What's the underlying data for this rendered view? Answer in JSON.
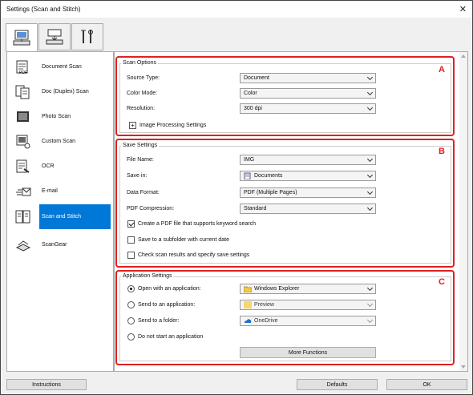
{
  "window": {
    "title": "Settings (Scan and Stitch)"
  },
  "tabs": [
    {
      "name": "scan-from-computer-tab"
    },
    {
      "name": "scan-from-panel-tab"
    },
    {
      "name": "general-settings-tab"
    }
  ],
  "nav": {
    "items": [
      {
        "label": "Document Scan",
        "icon": "document-scan-icon"
      },
      {
        "label": "Doc (Duplex) Scan",
        "icon": "duplex-scan-icon"
      },
      {
        "label": "Photo Scan",
        "icon": "photo-scan-icon"
      },
      {
        "label": "Custom Scan",
        "icon": "custom-scan-icon"
      },
      {
        "label": "OCR",
        "icon": "ocr-icon"
      },
      {
        "label": "E-mail",
        "icon": "email-icon"
      },
      {
        "label": "Scan and Stitch",
        "icon": "scan-stitch-icon",
        "selected": true
      },
      {
        "label": "ScanGear",
        "icon": "scangear-icon"
      }
    ]
  },
  "scan_options": {
    "title": "Scan Options",
    "letter": "A",
    "source_type_label": "Source Type:",
    "source_type_value": "Document",
    "color_mode_label": "Color Mode:",
    "color_mode_value": "Color",
    "resolution_label": "Resolution:",
    "resolution_value": "300 dpi",
    "image_processing_label": "Image Processing Settings",
    "expand_symbol": "+"
  },
  "save_settings": {
    "title": "Save Settings",
    "letter": "B",
    "file_name_label": "File Name:",
    "file_name_value": "IMG",
    "save_in_label": "Save in:",
    "save_in_value": "Documents",
    "data_format_label": "Data Format:",
    "data_format_value": "PDF (Multiple Pages)",
    "pdf_compression_label": "PDF Compression:",
    "pdf_compression_value": "Standard",
    "checkbox_keyword_label": "Create a PDF file that supports keyword search",
    "checkbox_keyword_checked": true,
    "checkbox_subfolder_label": "Save to a subfolder with current date",
    "checkbox_subfolder_checked": false,
    "checkbox_check_results_label": "Check scan results and specify save settings",
    "checkbox_check_results_checked": false
  },
  "application_settings": {
    "title": "Application Settings",
    "letter": "C",
    "open_app_label": "Open with an application:",
    "open_app_value": "Windows Explorer",
    "send_app_label": "Send to an application:",
    "send_app_value": "Preview",
    "send_folder_label": "Send to a folder:",
    "send_folder_value": "OneDrive",
    "no_app_label": "Do not start an application",
    "more_functions_label": "More Functions",
    "selected": "open_app"
  },
  "footer": {
    "instructions_label": "Instructions",
    "defaults_label": "Defaults",
    "ok_label": "OK"
  },
  "colors": {
    "highlight": "#0078d7",
    "annotation": "#e02020"
  }
}
